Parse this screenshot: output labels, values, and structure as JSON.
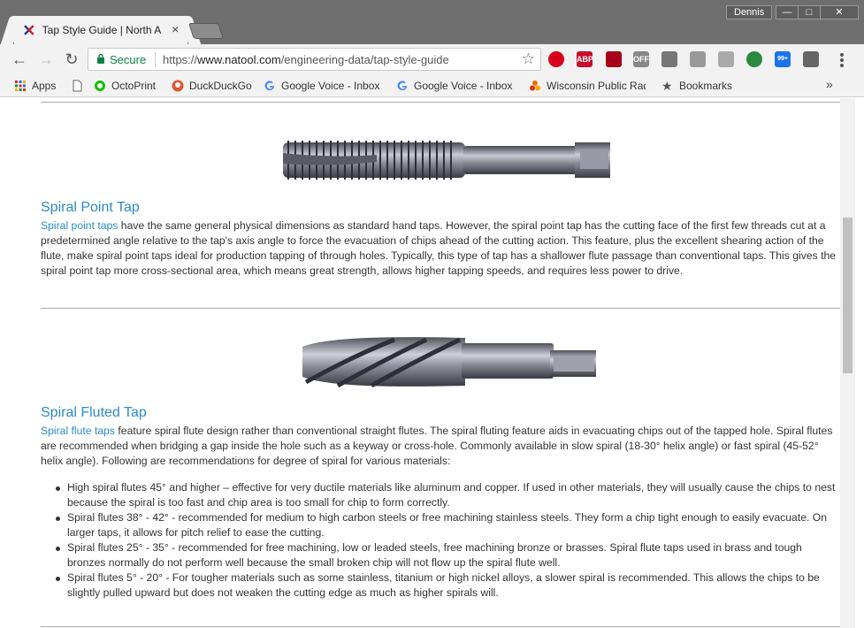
{
  "window": {
    "user_name": "Dennis",
    "minimize": "—",
    "maximize": "□",
    "close": "✕"
  },
  "tab": {
    "title": "Tap Style Guide | North A",
    "close": "×"
  },
  "toolbar": {
    "secure_label": "Secure",
    "url_scheme": "https://",
    "url_domain": "www.natool.com",
    "url_path": "/engineering-data/tap-style-guide",
    "star_icon": "☆",
    "extensions": [
      {
        "name": "opera-icon",
        "color": "#d8001b",
        "label": ""
      },
      {
        "name": "adblock-plus-icon",
        "color": "#c70d2c",
        "label": "ABP"
      },
      {
        "name": "ublock-icon",
        "color": "#a7001a",
        "label": ""
      },
      {
        "name": "off-icon",
        "color": "#888888",
        "label": "OFF"
      },
      {
        "name": "notes-icon",
        "color": "#777777",
        "label": ""
      },
      {
        "name": "link-icon",
        "color": "#999999",
        "label": ""
      },
      {
        "name": "drive-icon",
        "color": "#aaaaaa",
        "label": ""
      },
      {
        "name": "hangouts-icon",
        "color": "#2b8a3e",
        "label": ""
      },
      {
        "name": "mail-checker-icon",
        "color": "#1a73e8",
        "label": "99+"
      },
      {
        "name": "extension-gear-icon",
        "color": "#666666",
        "label": ""
      }
    ]
  },
  "bookmarks": {
    "items": [
      {
        "label": "Apps",
        "icon": "apps-grid-icon"
      },
      {
        "label": "",
        "icon": "page-icon"
      },
      {
        "label": "OctoPrint",
        "icon": "octoprint-icon"
      },
      {
        "label": "DuckDuckGo",
        "icon": "duckduckgo-icon"
      },
      {
        "label": "Google Voice - Inbox",
        "icon": "google-icon"
      },
      {
        "label": "Google Voice - Inbox",
        "icon": "google-icon"
      },
      {
        "label": "Wisconsin Public Radio",
        "icon": "wpr-icon"
      },
      {
        "label": "Bookmarks",
        "icon": "star-icon"
      }
    ],
    "more": "»"
  },
  "content": {
    "spiral_point": {
      "heading": "Spiral Point Tap",
      "link": "Spiral point taps",
      "body": " have the same general physical dimensions as standard hand taps.  However, the spiral point tap has the cutting face of the first few threads cut at a predetermined angle relative to the tap's axis angle to force the evacuation of chips ahead of the cutting action.  This feature, plus the excellent shearing action of the flute, make spiral point taps ideal for production tapping of through holes.  Typically, this type of tap has a shallower flute passage than conventional taps.  This gives the spiral point tap more cross-sectional area, which means great strength, allows higher tapping speeds, and requires less power to drive."
    },
    "spiral_fluted": {
      "heading": "Spiral Fluted Tap",
      "link": "Spiral flute taps",
      "body": " feature spiral flute design rather than conventional straight flutes. The spiral fluting feature aids in evacuating chips out of the tapped hole. Spiral flutes are recommended when bridging a gap inside the hole such as a keyway or cross-hole. Commonly available in slow spiral (18-30° helix angle) or fast spiral (45-52° helix angle). Following are recommendations for degree of spiral for various materials:",
      "tips": [
        "High spiral flutes 45° and higher – effective for very ductile materials like aluminum and copper. If used in other materials, they will usually cause the chips to nest because the spiral is too fast and chip area is too small for chip to form correctly.",
        "Spiral flutes 38° - 42° - recommended for medium to high carbon steels or free machining stainless steels. They form a chip tight enough to easily evacuate. On larger taps, it allows for pitch relief to ease the cutting.",
        "Spiral flutes 25° - 35° - recommended for free machining, low or leaded steels, free machining bronze or brasses. Spiral flute taps used in brass and tough bronzes normally do not perform well because the small broken chip will not flow up the spiral flute well.",
        "Spiral flutes 5° - 20° - For tougher materials such as some stainless, titanium or high nickel alloys, a slower spiral is recommended. This allows the chips to be slightly pulled upward but does not weaken the cutting edge as much as higher spirals will."
      ]
    }
  }
}
